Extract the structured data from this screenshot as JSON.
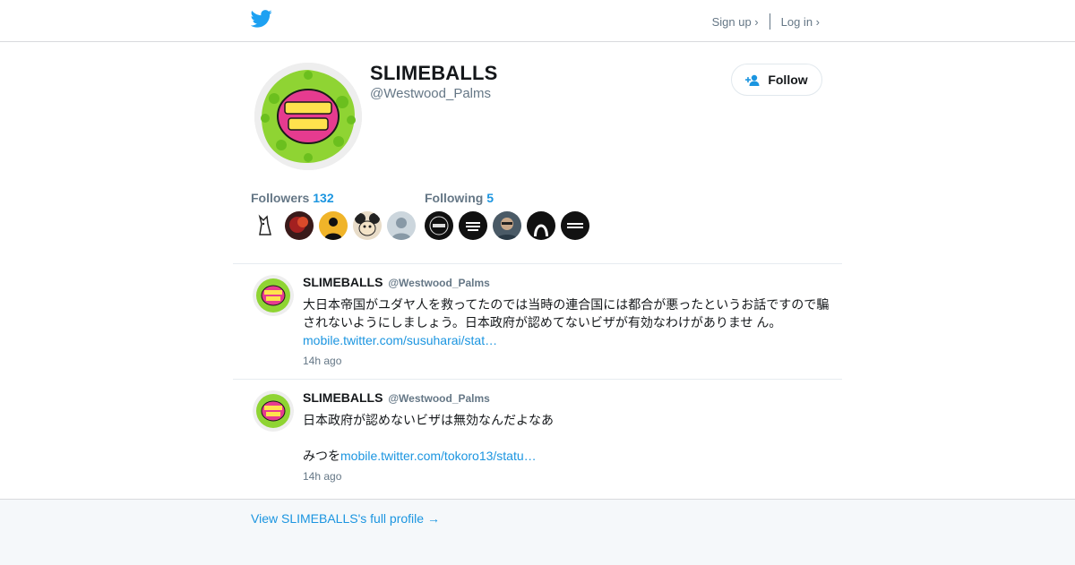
{
  "nav": {
    "signup_label": "Sign up ›",
    "login_label": "Log in ›"
  },
  "profile": {
    "name": "SLIMEBALLS",
    "handle": "@Westwood_Palms",
    "follow_label": "Follow"
  },
  "stats": {
    "followers_label": "Followers",
    "followers_count": "132",
    "following_label": "Following",
    "following_count": "5"
  },
  "tweets": [
    {
      "name": "SLIMEBALLS",
      "handle": "@Westwood_Palms",
      "text": "大日本帝国がユダヤ人を救ってたのでは当時の連合国には都合が悪ったというお話ですので騙されないようにしましょう。日本政府が認めてないビザが有効なわけがありませ ん。",
      "link": "mobile.twitter.com/susuharai/stat…",
      "time": "14h ago"
    },
    {
      "name": "SLIMEBALLS",
      "handle": "@Westwood_Palms",
      "text_line1": "日本政府が認めないビザは無効なんだよなあ",
      "text_line2": "みつを",
      "link": "mobile.twitter.com/tokoro13/statu…",
      "time": "14h ago"
    }
  ],
  "footer": {
    "full_profile_label": "View SLIMEBALLS's full profile →"
  },
  "colors": {
    "accent": "#1b95e0",
    "muted": "#657786",
    "bird": "#1da1f2",
    "footer_bg": "#f5f8fa"
  }
}
